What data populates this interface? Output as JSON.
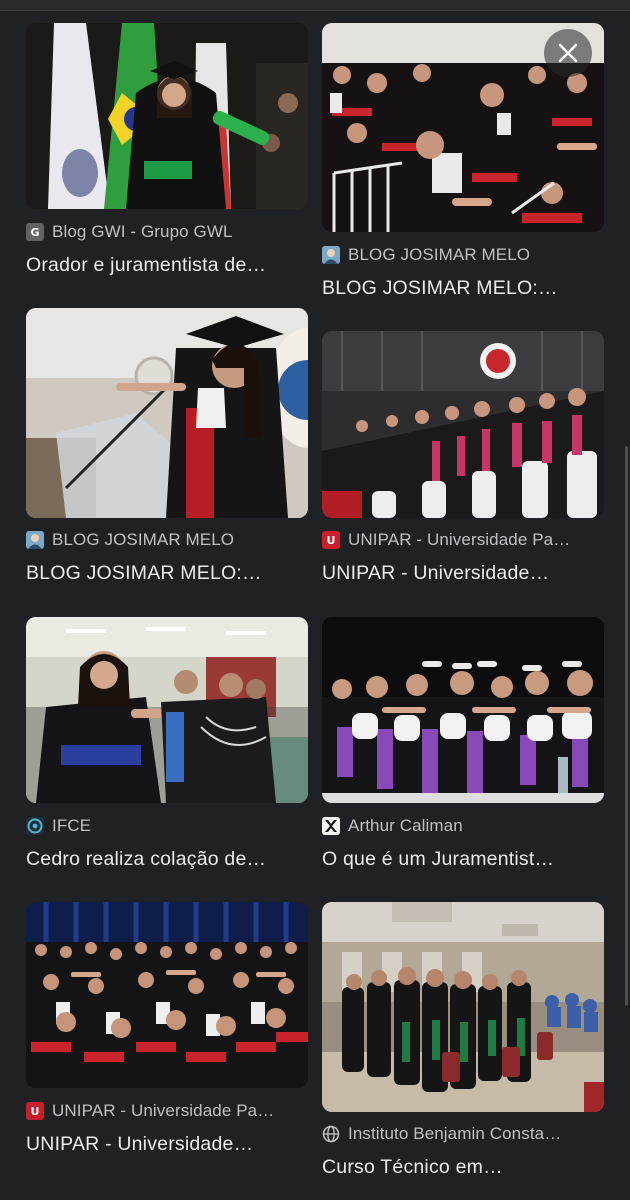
{
  "results": [
    {
      "source": "Blog GWI - Grupo GWL",
      "title": "Orador e juramentista de…",
      "favicon": "g-letter-favicon"
    },
    {
      "source": "BLOG JOSIMAR MELO",
      "title": "BLOG JOSIMAR MELO:…",
      "favicon": "avatar-favicon"
    },
    {
      "source": "BLOG JOSIMAR MELO",
      "title": "BLOG JOSIMAR MELO:…",
      "favicon": "avatar-favicon"
    },
    {
      "source": "UNIPAR - Universidade Pa…",
      "title": "UNIPAR - Universidade…",
      "favicon": "unipar-favicon"
    },
    {
      "source": "IFCE",
      "title": "Cedro realiza colação de…",
      "favicon": "ifce-favicon"
    },
    {
      "source": "Arthur Caliman",
      "title": "O que é um Juramentist…",
      "favicon": "arthur-favicon"
    },
    {
      "source": "UNIPAR - Universidade Pa…",
      "title": "UNIPAR - Universidade…",
      "favicon": "unipar-favicon"
    },
    {
      "source": "Instituto Benjamin Consta…",
      "title": "Curso Técnico em…",
      "favicon": "globe-favicon"
    }
  ],
  "close_icon": "close-icon",
  "colors": {
    "background": "#202124",
    "source_text": "#bdc1c6",
    "title_text": "#e8eaed"
  }
}
